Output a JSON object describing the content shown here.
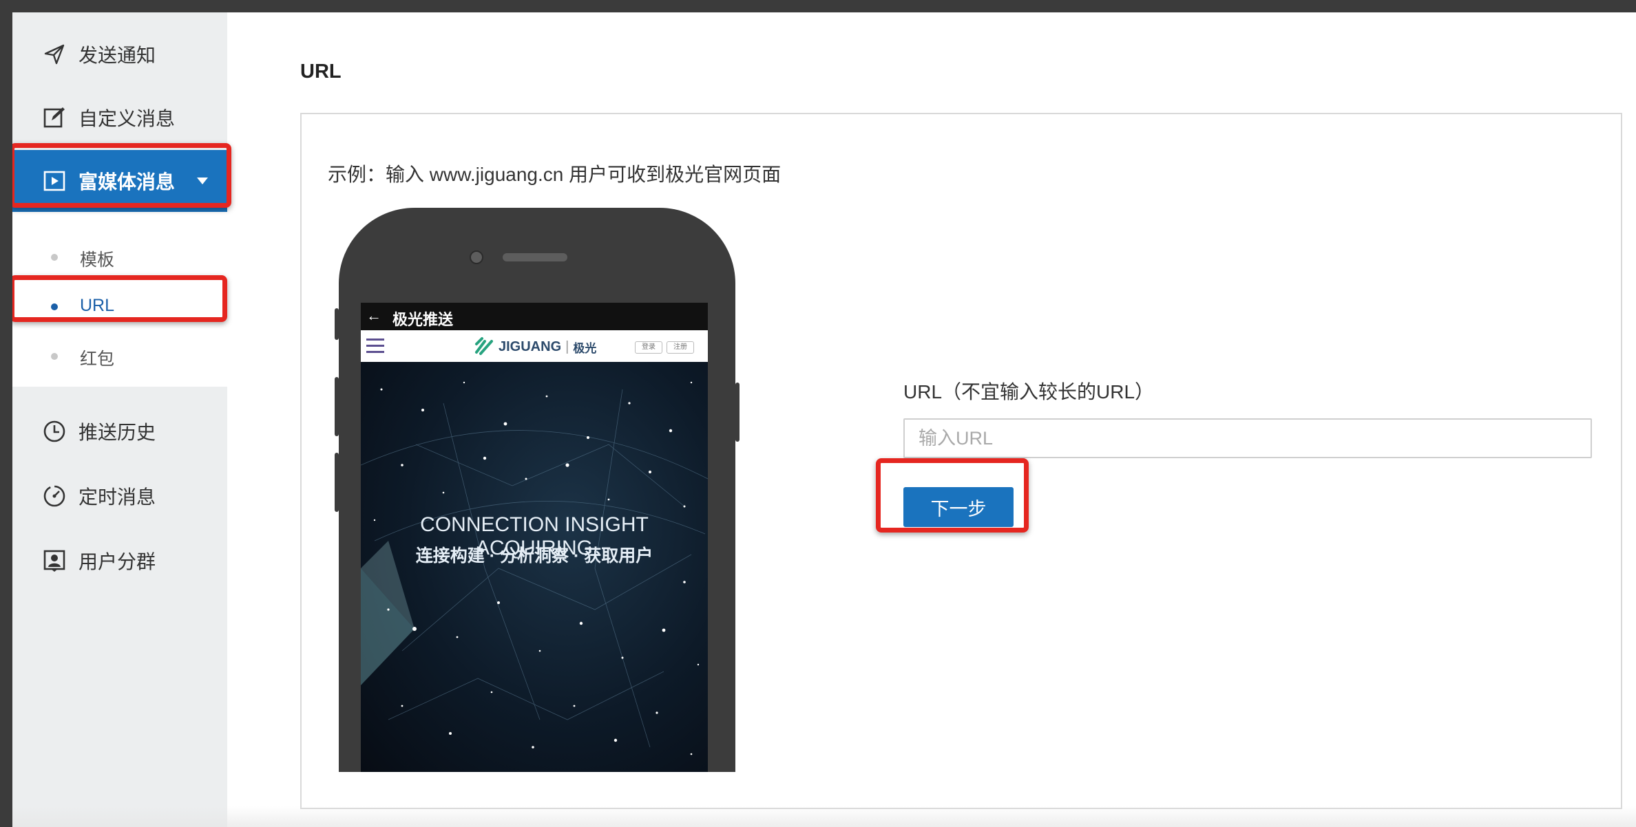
{
  "sidebar": {
    "items": [
      {
        "label": "发送通知",
        "icon": "send-icon"
      },
      {
        "label": "自定义消息",
        "icon": "edit-icon"
      },
      {
        "label": "富媒体消息",
        "icon": "play-icon"
      },
      {
        "label": "推送历史",
        "icon": "clock-icon"
      },
      {
        "label": "定时消息",
        "icon": "timer-icon"
      },
      {
        "label": "用户分群",
        "icon": "user-group-icon"
      }
    ],
    "submenu": [
      {
        "label": "模板"
      },
      {
        "label": "URL"
      },
      {
        "label": "红包"
      }
    ]
  },
  "main": {
    "title": "URL",
    "example": "示例：输入 www.jiguang.cn 用户可收到极光官网页面",
    "phone": {
      "status_title": "极光推送",
      "brand": "JIGUANG",
      "brand_cn": "极光",
      "login": "登录",
      "register": "注册",
      "tagline": "CONNECTION INSIGHT ACQUIRING",
      "tagline_cn": "连接构建 · 分析洞察 · 获取用户"
    },
    "form": {
      "url_label": "URL（不宜输入较长的URL）",
      "url_placeholder": "输入URL",
      "url_value": "",
      "next_label": "下一步"
    }
  },
  "colors": {
    "accent": "#1a73be",
    "highlight": "#e52620",
    "sidebar_bg": "#eceeef"
  }
}
